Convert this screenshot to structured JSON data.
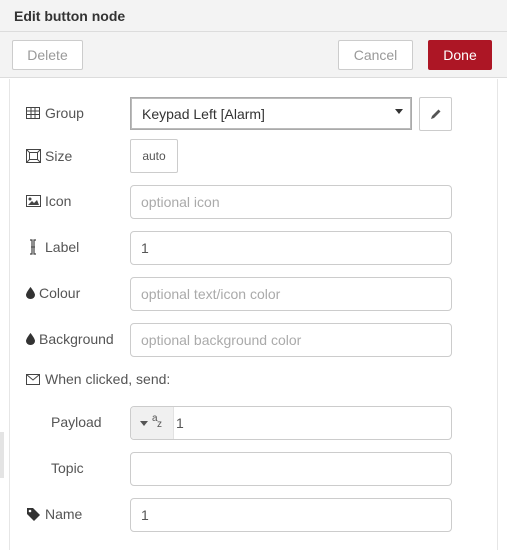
{
  "header": {
    "title": "Edit button node"
  },
  "toolbar": {
    "delete_label": "Delete",
    "cancel_label": "Cancel",
    "done_label": "Done"
  },
  "form": {
    "group": {
      "label": "Group",
      "value": "Keypad Left [Alarm]"
    },
    "size": {
      "label": "Size",
      "value": "auto"
    },
    "icon": {
      "label": "Icon",
      "placeholder": "optional icon",
      "value": ""
    },
    "label_field": {
      "label": "Label",
      "value": "1"
    },
    "colour": {
      "label": "Colour",
      "placeholder": "optional text/icon color",
      "value": ""
    },
    "background": {
      "label": "Background",
      "placeholder": "optional background color",
      "value": ""
    },
    "when_clicked": {
      "label": "When clicked, send:"
    },
    "payload": {
      "label": "Payload",
      "type": "string",
      "value": "1"
    },
    "topic": {
      "label": "Topic",
      "value": ""
    },
    "name": {
      "label": "Name",
      "value": "1"
    }
  },
  "colors": {
    "done_button": "#ad1625",
    "header_bg": "#f3f3f3"
  },
  "icons": {
    "group": "table-icon",
    "size": "resize-icon",
    "icon": "image-icon",
    "label": "text-cursor-icon",
    "colour": "droplet-icon",
    "background": "droplet-icon",
    "when_clicked": "envelope-icon",
    "name": "tag-icon",
    "edit": "pencil-icon"
  }
}
